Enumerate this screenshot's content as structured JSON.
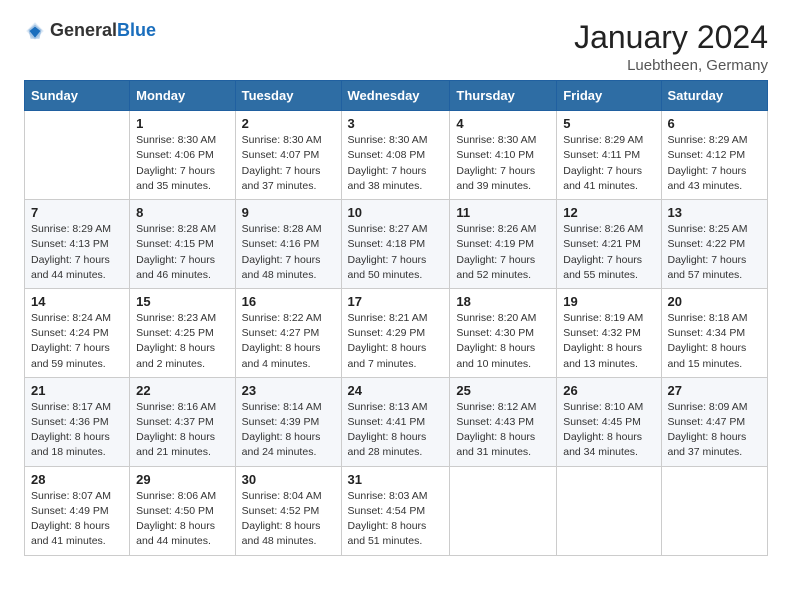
{
  "header": {
    "logo_general": "General",
    "logo_blue": "Blue",
    "title": "January 2024",
    "subtitle": "Luebtheen, Germany"
  },
  "columns": [
    "Sunday",
    "Monday",
    "Tuesday",
    "Wednesday",
    "Thursday",
    "Friday",
    "Saturday"
  ],
  "weeks": [
    [
      {
        "day": "",
        "sunrise": "",
        "sunset": "",
        "daylight": ""
      },
      {
        "day": "1",
        "sunrise": "Sunrise: 8:30 AM",
        "sunset": "Sunset: 4:06 PM",
        "daylight": "Daylight: 7 hours and 35 minutes."
      },
      {
        "day": "2",
        "sunrise": "Sunrise: 8:30 AM",
        "sunset": "Sunset: 4:07 PM",
        "daylight": "Daylight: 7 hours and 37 minutes."
      },
      {
        "day": "3",
        "sunrise": "Sunrise: 8:30 AM",
        "sunset": "Sunset: 4:08 PM",
        "daylight": "Daylight: 7 hours and 38 minutes."
      },
      {
        "day": "4",
        "sunrise": "Sunrise: 8:30 AM",
        "sunset": "Sunset: 4:10 PM",
        "daylight": "Daylight: 7 hours and 39 minutes."
      },
      {
        "day": "5",
        "sunrise": "Sunrise: 8:29 AM",
        "sunset": "Sunset: 4:11 PM",
        "daylight": "Daylight: 7 hours and 41 minutes."
      },
      {
        "day": "6",
        "sunrise": "Sunrise: 8:29 AM",
        "sunset": "Sunset: 4:12 PM",
        "daylight": "Daylight: 7 hours and 43 minutes."
      }
    ],
    [
      {
        "day": "7",
        "sunrise": "Sunrise: 8:29 AM",
        "sunset": "Sunset: 4:13 PM",
        "daylight": "Daylight: 7 hours and 44 minutes."
      },
      {
        "day": "8",
        "sunrise": "Sunrise: 8:28 AM",
        "sunset": "Sunset: 4:15 PM",
        "daylight": "Daylight: 7 hours and 46 minutes."
      },
      {
        "day": "9",
        "sunrise": "Sunrise: 8:28 AM",
        "sunset": "Sunset: 4:16 PM",
        "daylight": "Daylight: 7 hours and 48 minutes."
      },
      {
        "day": "10",
        "sunrise": "Sunrise: 8:27 AM",
        "sunset": "Sunset: 4:18 PM",
        "daylight": "Daylight: 7 hours and 50 minutes."
      },
      {
        "day": "11",
        "sunrise": "Sunrise: 8:26 AM",
        "sunset": "Sunset: 4:19 PM",
        "daylight": "Daylight: 7 hours and 52 minutes."
      },
      {
        "day": "12",
        "sunrise": "Sunrise: 8:26 AM",
        "sunset": "Sunset: 4:21 PM",
        "daylight": "Daylight: 7 hours and 55 minutes."
      },
      {
        "day": "13",
        "sunrise": "Sunrise: 8:25 AM",
        "sunset": "Sunset: 4:22 PM",
        "daylight": "Daylight: 7 hours and 57 minutes."
      }
    ],
    [
      {
        "day": "14",
        "sunrise": "Sunrise: 8:24 AM",
        "sunset": "Sunset: 4:24 PM",
        "daylight": "Daylight: 7 hours and 59 minutes."
      },
      {
        "day": "15",
        "sunrise": "Sunrise: 8:23 AM",
        "sunset": "Sunset: 4:25 PM",
        "daylight": "Daylight: 8 hours and 2 minutes."
      },
      {
        "day": "16",
        "sunrise": "Sunrise: 8:22 AM",
        "sunset": "Sunset: 4:27 PM",
        "daylight": "Daylight: 8 hours and 4 minutes."
      },
      {
        "day": "17",
        "sunrise": "Sunrise: 8:21 AM",
        "sunset": "Sunset: 4:29 PM",
        "daylight": "Daylight: 8 hours and 7 minutes."
      },
      {
        "day": "18",
        "sunrise": "Sunrise: 8:20 AM",
        "sunset": "Sunset: 4:30 PM",
        "daylight": "Daylight: 8 hours and 10 minutes."
      },
      {
        "day": "19",
        "sunrise": "Sunrise: 8:19 AM",
        "sunset": "Sunset: 4:32 PM",
        "daylight": "Daylight: 8 hours and 13 minutes."
      },
      {
        "day": "20",
        "sunrise": "Sunrise: 8:18 AM",
        "sunset": "Sunset: 4:34 PM",
        "daylight": "Daylight: 8 hours and 15 minutes."
      }
    ],
    [
      {
        "day": "21",
        "sunrise": "Sunrise: 8:17 AM",
        "sunset": "Sunset: 4:36 PM",
        "daylight": "Daylight: 8 hours and 18 minutes."
      },
      {
        "day": "22",
        "sunrise": "Sunrise: 8:16 AM",
        "sunset": "Sunset: 4:37 PM",
        "daylight": "Daylight: 8 hours and 21 minutes."
      },
      {
        "day": "23",
        "sunrise": "Sunrise: 8:14 AM",
        "sunset": "Sunset: 4:39 PM",
        "daylight": "Daylight: 8 hours and 24 minutes."
      },
      {
        "day": "24",
        "sunrise": "Sunrise: 8:13 AM",
        "sunset": "Sunset: 4:41 PM",
        "daylight": "Daylight: 8 hours and 28 minutes."
      },
      {
        "day": "25",
        "sunrise": "Sunrise: 8:12 AM",
        "sunset": "Sunset: 4:43 PM",
        "daylight": "Daylight: 8 hours and 31 minutes."
      },
      {
        "day": "26",
        "sunrise": "Sunrise: 8:10 AM",
        "sunset": "Sunset: 4:45 PM",
        "daylight": "Daylight: 8 hours and 34 minutes."
      },
      {
        "day": "27",
        "sunrise": "Sunrise: 8:09 AM",
        "sunset": "Sunset: 4:47 PM",
        "daylight": "Daylight: 8 hours and 37 minutes."
      }
    ],
    [
      {
        "day": "28",
        "sunrise": "Sunrise: 8:07 AM",
        "sunset": "Sunset: 4:49 PM",
        "daylight": "Daylight: 8 hours and 41 minutes."
      },
      {
        "day": "29",
        "sunrise": "Sunrise: 8:06 AM",
        "sunset": "Sunset: 4:50 PM",
        "daylight": "Daylight: 8 hours and 44 minutes."
      },
      {
        "day": "30",
        "sunrise": "Sunrise: 8:04 AM",
        "sunset": "Sunset: 4:52 PM",
        "daylight": "Daylight: 8 hours and 48 minutes."
      },
      {
        "day": "31",
        "sunrise": "Sunrise: 8:03 AM",
        "sunset": "Sunset: 4:54 PM",
        "daylight": "Daylight: 8 hours and 51 minutes."
      },
      {
        "day": "",
        "sunrise": "",
        "sunset": "",
        "daylight": ""
      },
      {
        "day": "",
        "sunrise": "",
        "sunset": "",
        "daylight": ""
      },
      {
        "day": "",
        "sunrise": "",
        "sunset": "",
        "daylight": ""
      }
    ]
  ]
}
